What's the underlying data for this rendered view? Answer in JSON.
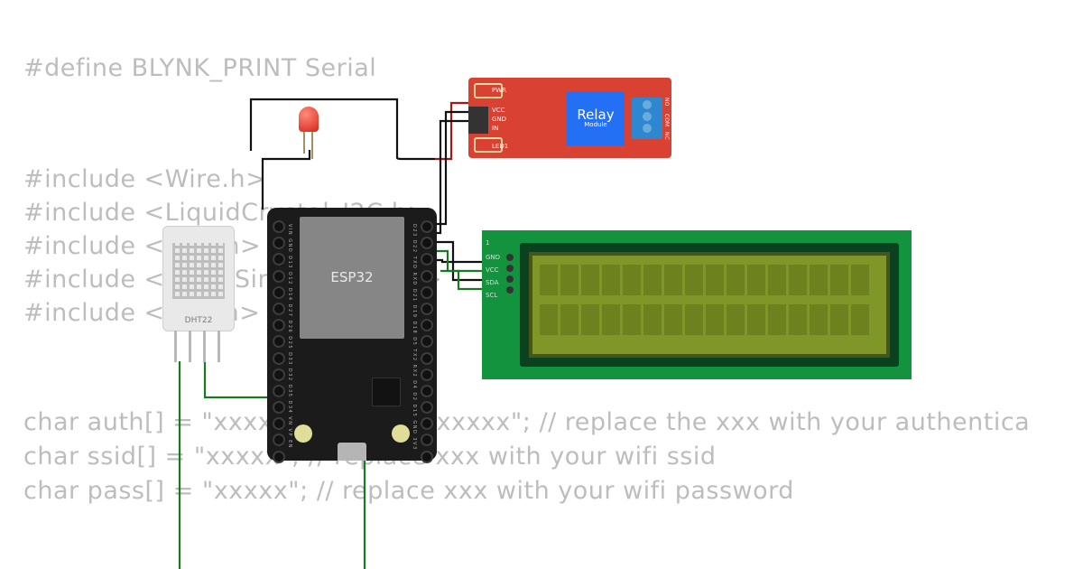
{
  "code": {
    "l1": "#define BLYNK_PRINT Serial",
    "l2": "#include <Wire.h>",
    "l3": "#include <LiquidCrystal_I2C.h>",
    "l4": "#include <WiFi.h>",
    "l5": "#include <BlynkSimpleEsp32.h>",
    "l6": "#include <DHT.h>",
    "l7": "char auth[] = \"xxxxxxxxxxxxxxxxxxxx\"; // replace the xxx with your authentica",
    "l8": "char ssid[] = \"xxxxx\"; // replace xxx with your wifi ssid",
    "l9": "char pass[] = \"xxxxx\"; // replace xxx with your wifi password"
  },
  "components": {
    "esp32": {
      "label": "ESP32",
      "pins_left": "D23 D22 TXD RXD D21 D19 D18 D5 TX2 RX2 D4 D2 D15 GND 3V3",
      "pins_right": "VIN GND D13 D12 D14 D27 D26 D25 D33 D32 D35 D34 VN VP EN"
    },
    "dht22": {
      "label": "DHT22"
    },
    "relay": {
      "title": "Relay",
      "subtitle": "Module",
      "pins": {
        "pwr": "PWR",
        "vcc": "VCC",
        "gnd": "GND",
        "in": "IN",
        "led1": "LED1"
      },
      "terms": {
        "no": "NO",
        "com": "COM",
        "nc": "NC"
      }
    },
    "lcd": {
      "num": "1",
      "pins": {
        "gnd": "GND",
        "vcc": "VCC",
        "sda": "SDA",
        "scl": "SCL"
      }
    }
  },
  "wires": [
    {
      "id": "dht-data",
      "color": "#177a1e"
    },
    {
      "id": "lcd-bus",
      "color": "#177a1e"
    },
    {
      "id": "relay-sig",
      "color": "#111"
    },
    {
      "id": "relay-pwr",
      "color": "#a21916"
    },
    {
      "id": "led-gnd",
      "color": "#111"
    }
  ]
}
